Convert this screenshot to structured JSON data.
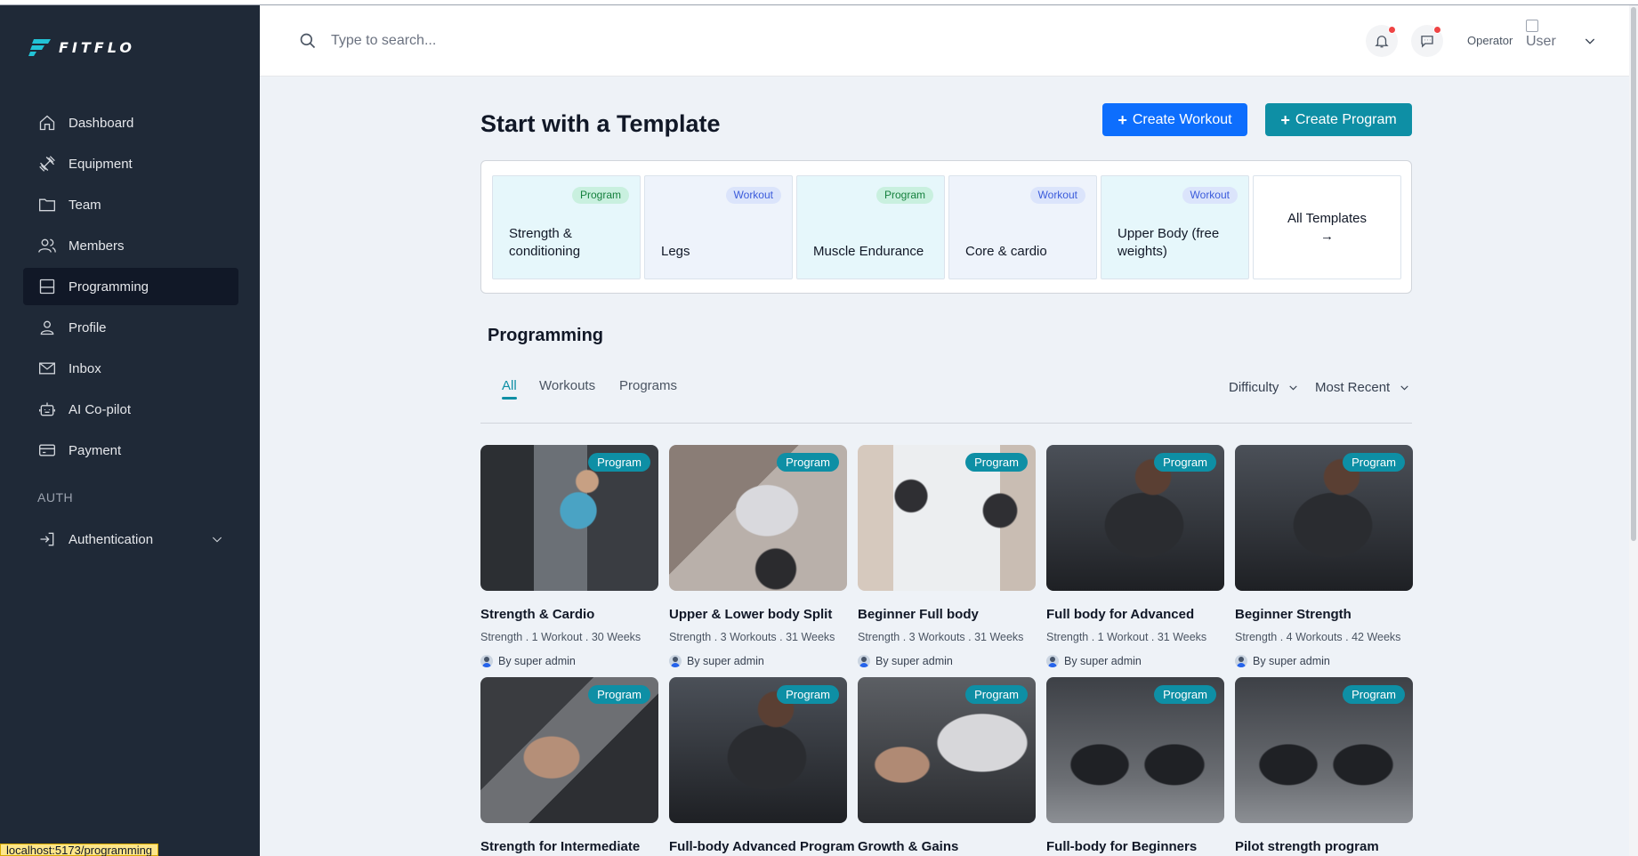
{
  "app": {
    "logo_text": "FITFLO",
    "status_url": "localhost:5173/programming"
  },
  "sidebar": {
    "items": [
      {
        "label": "Dashboard",
        "icon": "home-icon"
      },
      {
        "label": "Equipment",
        "icon": "dumbbell-icon"
      },
      {
        "label": "Team",
        "icon": "folder-icon"
      },
      {
        "label": "Members",
        "icon": "users-icon"
      },
      {
        "label": "Programming",
        "icon": "layout-icon",
        "active": true
      },
      {
        "label": "Profile",
        "icon": "user-icon"
      },
      {
        "label": "Inbox",
        "icon": "mail-icon"
      },
      {
        "label": "AI Co-pilot",
        "icon": "robot-icon"
      },
      {
        "label": "Payment",
        "icon": "credit-card-icon"
      }
    ],
    "auth_heading": "AUTH",
    "auth_item": "Authentication"
  },
  "topbar": {
    "search_placeholder": "Type to search...",
    "role": "Operator",
    "avatar_alt": "User"
  },
  "header": {
    "title": "Start with a Template",
    "create_workout": "Create Workout",
    "create_program": "Create Program"
  },
  "templates": [
    {
      "type": "Program",
      "name": "Strength & conditioning"
    },
    {
      "type": "Workout",
      "name": "Legs"
    },
    {
      "type": "Program",
      "name": "Muscle Endurance"
    },
    {
      "type": "Workout",
      "name": "Core & cardio"
    },
    {
      "type": "Workout",
      "name": "Upper Body (free weights)"
    }
  ],
  "all_templates": {
    "label": "All Templates",
    "arrow": "→"
  },
  "programming": {
    "title": "Programming",
    "tabs": [
      "All",
      "Workouts",
      "Programs"
    ],
    "filters": {
      "difficulty": "Difficulty",
      "sort": "Most Recent"
    }
  },
  "cards": [
    {
      "badge": "Program",
      "title": "Strength & Cardio",
      "meta": "Strength . 1 Workout . 30 Weeks",
      "author": "By super admin"
    },
    {
      "badge": "Program",
      "title": "Upper & Lower body Split",
      "meta": "Strength . 3 Workouts . 31 Weeks",
      "author": "By super admin"
    },
    {
      "badge": "Program",
      "title": "Beginner Full body",
      "meta": "Strength . 3 Workouts . 31 Weeks",
      "author": "By super admin"
    },
    {
      "badge": "Program",
      "title": "Full body for Advanced",
      "meta": "Strength . 1 Workout . 31 Weeks",
      "author": "By super admin"
    },
    {
      "badge": "Program",
      "title": "Beginner Strength",
      "meta": "Strength . 4 Workouts . 42 Weeks",
      "author": "By super admin"
    },
    {
      "badge": "Program",
      "title": "Strength for Intermediate"
    },
    {
      "badge": "Program",
      "title": "Full-body Advanced Program"
    },
    {
      "badge": "Program",
      "title": "Growth & Gains"
    },
    {
      "badge": "Program",
      "title": "Full-body for Beginners"
    },
    {
      "badge": "Program",
      "title": "Pilot strength program"
    }
  ],
  "colors": {
    "sidebar_bg": "#1f2937",
    "primary_blue": "#0d6efd",
    "teal": "#0e8fa5",
    "notification_dot": "#ef4444"
  }
}
